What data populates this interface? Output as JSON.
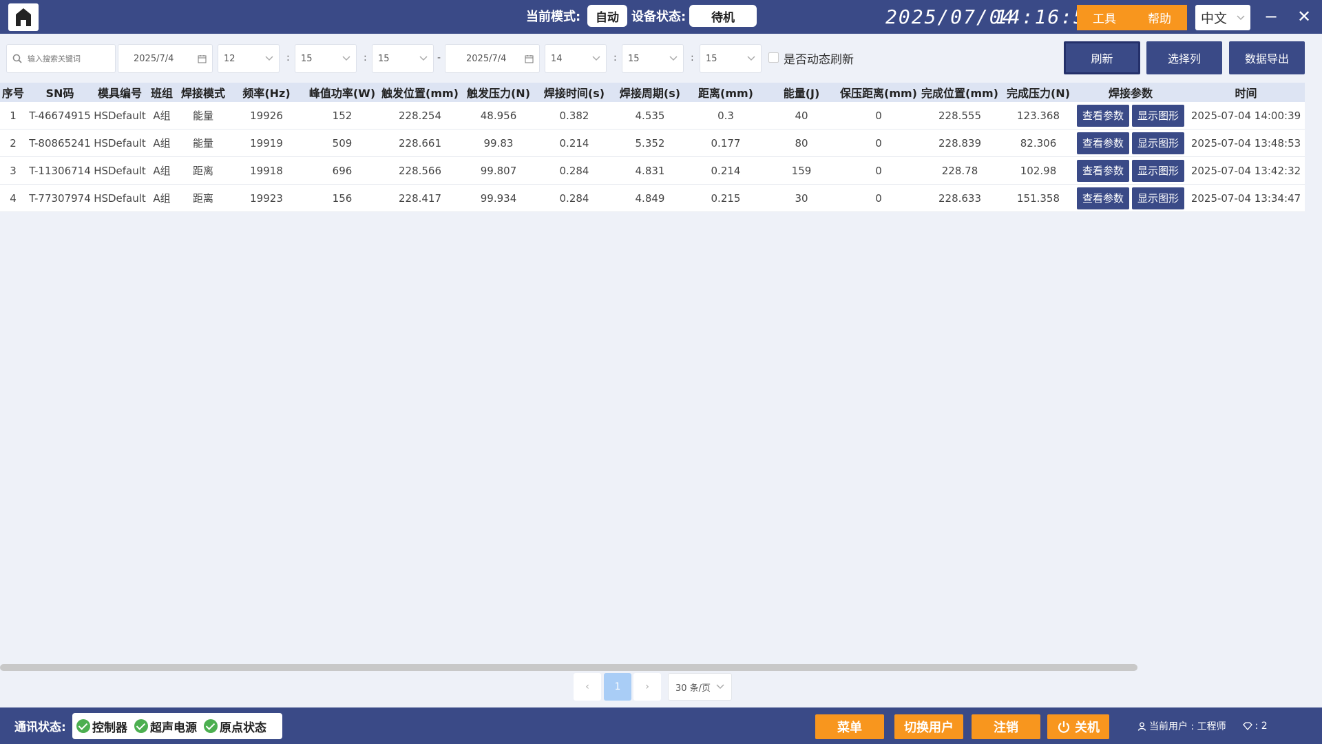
{
  "header": {
    "mode_label": "当前模式:",
    "mode_value": "自动",
    "status_label": "设备状态:",
    "status_value": "待机",
    "date": "2025/07/04",
    "time": "14:16:59",
    "tool_label": "工具",
    "help_label": "帮助",
    "language": "中文",
    "minimize": "−",
    "close": "✕"
  },
  "filters": {
    "search_placeholder": "输入搜索关键词",
    "start_date": "2025/7/4",
    "start_hour": "12",
    "start_minute": "15",
    "start_second": "15",
    "end_date": "2025/7/4",
    "end_hour": "14",
    "end_minute": "15",
    "end_second": "15",
    "time_sep": ":",
    "range_sep": "-",
    "auto_refresh_label": "是否动态刷新",
    "refresh_label": "刷新",
    "select_columns_label": "选择列",
    "export_label": "数据导出"
  },
  "table": {
    "columns": [
      "序号",
      "SN码",
      "模具编号",
      "班组",
      "焊接模式",
      "频率(Hz)",
      "峰值功率(W)",
      "触发位置(mm)",
      "触发压力(N)",
      "焊接时间(s)",
      "焊接周期(s)",
      "距离(mm)",
      "能量(J)",
      "保压距离(mm)",
      "完成位置(mm)",
      "完成压力(N)",
      "焊接参数",
      "时间"
    ],
    "view_params_label": "查看参数",
    "show_graph_label": "显示图形",
    "rows": [
      [
        "1",
        "T-46674915",
        "HSDefault",
        "A组",
        "能量",
        "19926",
        "152",
        "228.254",
        "48.956",
        "0.382",
        "4.535",
        "0.3",
        "40",
        "0",
        "228.555",
        "123.368",
        "2025-07-04 14:00:39"
      ],
      [
        "2",
        "T-80865241",
        "HSDefault",
        "A组",
        "能量",
        "19919",
        "509",
        "228.661",
        "99.83",
        "0.214",
        "5.352",
        "0.177",
        "80",
        "0",
        "228.839",
        "82.306",
        "2025-07-04 13:48:53"
      ],
      [
        "3",
        "T-11306714",
        "HSDefault",
        "A组",
        "距离",
        "19918",
        "696",
        "228.566",
        "99.807",
        "0.284",
        "4.831",
        "0.214",
        "159",
        "0",
        "228.78",
        "102.98",
        "2025-07-04 13:42:32"
      ],
      [
        "4",
        "T-77307974",
        "HSDefault",
        "A组",
        "距离",
        "19923",
        "156",
        "228.417",
        "99.934",
        "0.284",
        "4.849",
        "0.215",
        "30",
        "0",
        "228.633",
        "151.358",
        "2025-07-04 13:34:47"
      ]
    ]
  },
  "pagination": {
    "prev": "‹",
    "current_page": "1",
    "next": "›",
    "page_size": "30 条/页"
  },
  "footer": {
    "comm_label": "通讯状态:",
    "comm_items": [
      "控制器",
      "超声电源",
      "原点状态"
    ],
    "menu_label": "菜单",
    "switch_user_label": "切换用户",
    "logout_label": "注销",
    "shutdown_label": "关机",
    "current_user_label": "当前用户 : 工程师",
    "level_label": ": 2"
  }
}
